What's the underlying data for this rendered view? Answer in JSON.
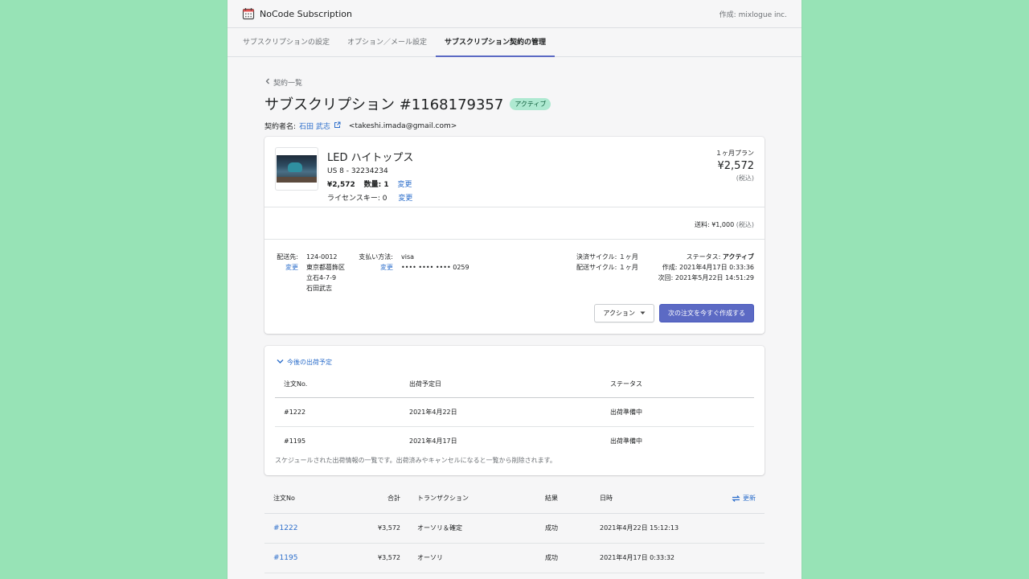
{
  "app": {
    "name": "NoCode Subscription",
    "maker": "作成: mixlogue inc."
  },
  "tabs": [
    {
      "label": "サブスクリプションの設定"
    },
    {
      "label": "オプション／メール設定"
    },
    {
      "label": "サブスクリプション契約の管理",
      "active": true
    }
  ],
  "back_link": "契約一覧",
  "title": "サブスクリプション #1168179357",
  "status_badge": "アクティブ",
  "contract": {
    "label": "契約者名:",
    "name": "石田 武志",
    "email": "<takeshi.imada@gmail.com>"
  },
  "product": {
    "name": "LED ハイトップス",
    "variant": "US 8 - 32234234",
    "price": "¥2,572",
    "qty_label": "数量: 1",
    "change": "変更",
    "license_label": "ライセンスキー: 0",
    "license_change": "変更"
  },
  "plan": {
    "name": "１ヶ月プラン",
    "price": "¥2,572",
    "tax": "(税込)"
  },
  "shipping_fee": {
    "label": "送料: ¥1,000",
    "tax": "(税込)"
  },
  "shipping_address": {
    "label": "配送先:",
    "change": "変更",
    "lines": [
      "124-0012",
      "東京都葛飾区",
      "立石4-7-9",
      "石田武志"
    ]
  },
  "payment": {
    "label": "支払い方法:",
    "change": "変更",
    "method": "visa",
    "card": "•••• •••• •••• 0259"
  },
  "cycles": {
    "billing": "決済サイクル: １ヶ月",
    "delivery": "配送サイクル: １ヶ月"
  },
  "status_info": {
    "status_label": "ステータス:",
    "status_value": "アクティブ",
    "created": "作成: 2021年4月17日 0:33:36",
    "next": "次回: 2021年5月22日 14:51:29"
  },
  "buttons": {
    "action": "アクション",
    "create_order": "次の注文を今すぐ作成する"
  },
  "upcoming": {
    "title": "今後の出荷予定",
    "headers": [
      "注文No.",
      "出荷予定日",
      "ステータス"
    ],
    "rows": [
      {
        "order": "#1222",
        "date": "2021年4月22日",
        "status": "出荷準備中"
      },
      {
        "order": "#1195",
        "date": "2021年4月17日",
        "status": "出荷準備中"
      }
    ],
    "note": "スケジュールされた出荷情報の一覧です。出荷済みやキャンセルになると一覧から削除されます。"
  },
  "transactions": {
    "headers": [
      "注文No",
      "合計",
      "トランザクション",
      "結果",
      "日時"
    ],
    "refresh": "更新",
    "rows": [
      {
        "order": "#1222",
        "total": "¥3,572",
        "type": "オーソリ＆確定",
        "result": "成功",
        "date": "2021年4月22日 15:12:13"
      },
      {
        "order": "#1195",
        "total": "¥3,572",
        "type": "オーソリ",
        "result": "成功",
        "date": "2021年4月17日 0:33:32"
      }
    ]
  },
  "colors": {
    "accent": "#5c6ac4",
    "link": "#2c6ecb",
    "badge_bg": "#aee9d1",
    "page_bg": "#97e3b6"
  }
}
